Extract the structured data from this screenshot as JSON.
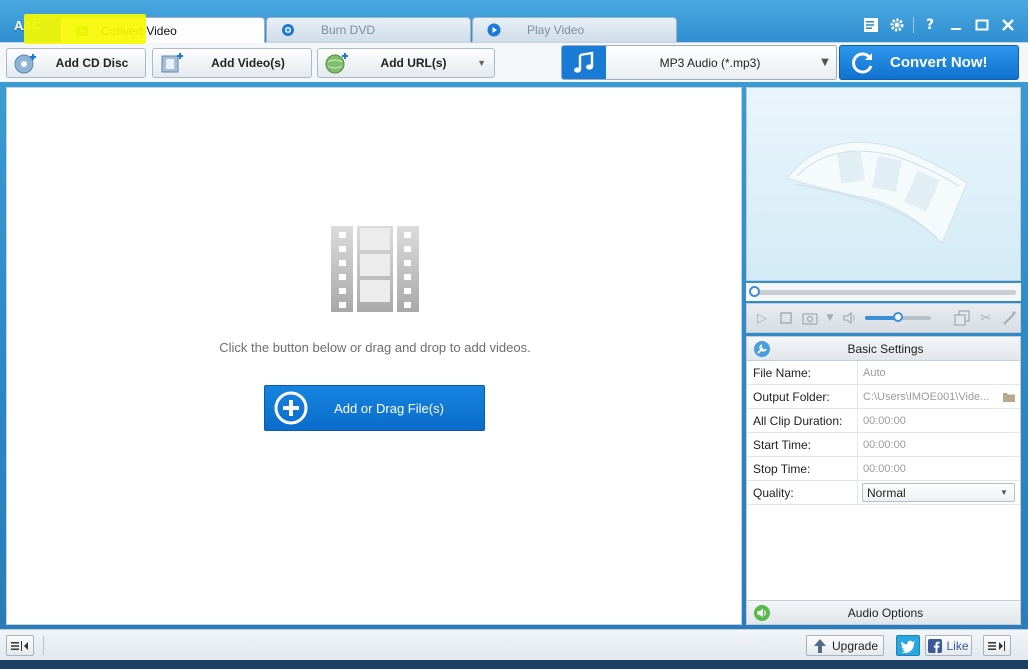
{
  "app": {
    "logo": "AAC"
  },
  "tabs": [
    {
      "label": "Convert Video",
      "icon": "convert-icon",
      "active": true
    },
    {
      "label": "Burn DVD",
      "icon": "disc-icon",
      "active": false
    },
    {
      "label": "Play Video",
      "icon": "play-circle-icon",
      "active": false
    }
  ],
  "window_controls": [
    "menu-icon",
    "gear-icon",
    "help-icon",
    "minimize-icon",
    "maximize-icon",
    "close-icon"
  ],
  "toolbar": {
    "add_cd": "Add CD Disc",
    "add_video": "Add Video(s)",
    "add_url": "Add URL(s)",
    "format": "MP3 Audio (*.mp3)",
    "convert": "Convert Now!"
  },
  "main": {
    "hint": "Click the button below or drag and drop to add videos.",
    "add_files": "Add or Drag File(s)"
  },
  "settings": {
    "title": "Basic Settings",
    "rows": [
      {
        "label": "File Name:",
        "value": "Auto"
      },
      {
        "label": "Output Folder:",
        "value": "C:\\Users\\IMOE001\\Vide..."
      },
      {
        "label": "All Clip Duration:",
        "value": "00:00:00"
      },
      {
        "label": "Start Time:",
        "value": "00:00:00"
      },
      {
        "label": "Stop Time:",
        "value": "00:00:00"
      },
      {
        "label": "Quality:",
        "value": "Normal"
      }
    ],
    "audio_options": "Audio Options"
  },
  "player": {
    "volume_fraction": 0.5
  },
  "statusbar": {
    "upgrade": "Upgrade",
    "like": "Like"
  },
  "colors": {
    "accent": "#1a7bd6",
    "highlight": "#f6f800",
    "titlebar": "#2f8fd0"
  }
}
